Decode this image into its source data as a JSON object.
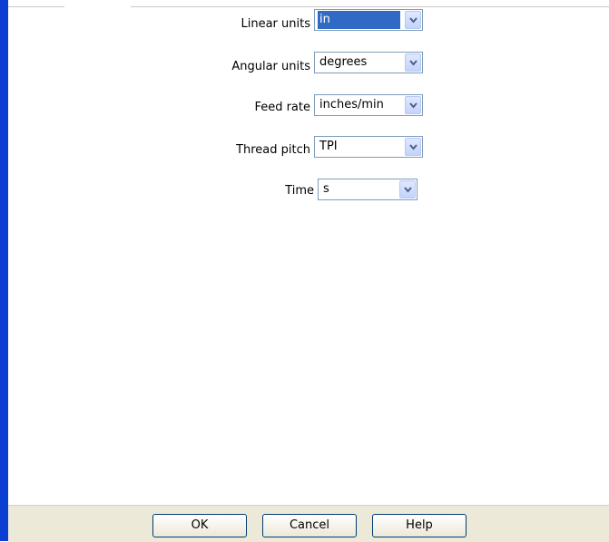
{
  "form": {
    "linear_units": {
      "label": "Linear units",
      "value": "in"
    },
    "angular_units": {
      "label": "Angular units",
      "value": "degrees"
    },
    "feed_rate": {
      "label": "Feed rate",
      "value": "inches/min"
    },
    "thread_pitch": {
      "label": "Thread pitch",
      "value": "TPI"
    },
    "time": {
      "label": "Time",
      "value": "s"
    }
  },
  "buttons": {
    "ok": "OK",
    "cancel": "Cancel",
    "help": "Help"
  },
  "colors": {
    "selection": "#316ac5",
    "window_border": "#0a3fd1",
    "footer_bg": "#ece9d8"
  },
  "icons": {
    "dropdown": "chevron-down-icon"
  }
}
